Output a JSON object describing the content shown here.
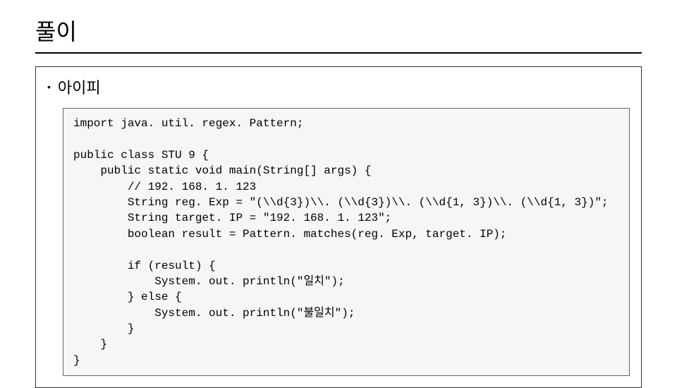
{
  "title": "풀이",
  "bullet": "아이피",
  "code": "import java. util. regex. Pattern;\n\npublic class STU 9 {\n    public static void main(String[] args) {\n        // 192. 168. 1. 123\n        String reg. Exp = \"(\\\\d{3})\\\\. (\\\\d{3})\\\\. (\\\\d{1, 3})\\\\. (\\\\d{1, 3})\";\n        String target. IP = \"192. 168. 1. 123\";\n        boolean result = Pattern. matches(reg. Exp, target. IP);\n\n        if (result) {\n            System. out. println(\"일치\");\n        } else {\n            System. out. println(\"불일치\");\n        }\n    }\n}"
}
